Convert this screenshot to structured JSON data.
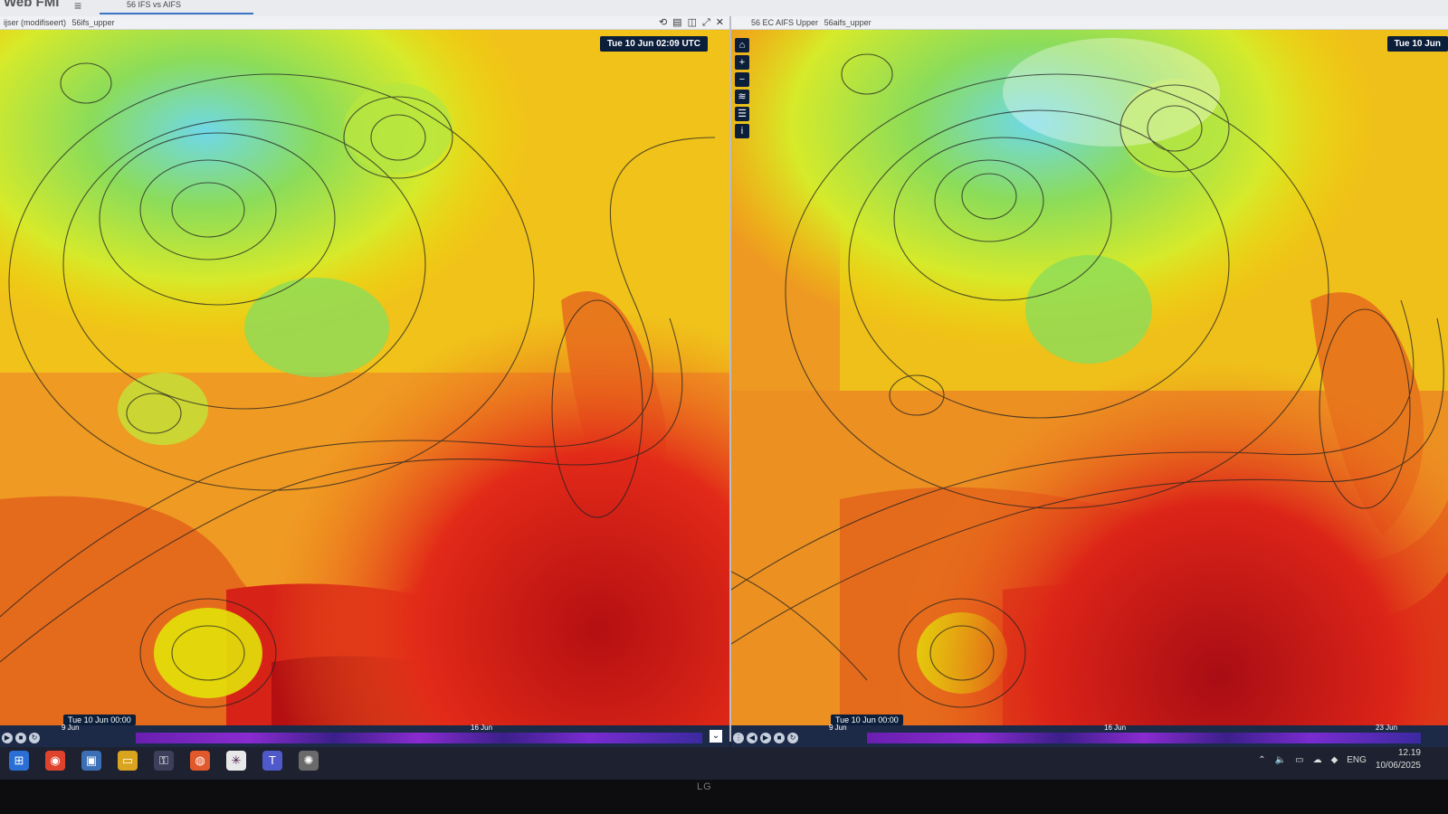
{
  "app": {
    "title": "Web FMI",
    "tab_label": "56 IFS vs AIFS"
  },
  "left_pane": {
    "title": "ijser (modifiseert)",
    "subtitle": "56ifs_upper",
    "time_badge": "Tue 10 Jun 02:09 UTC",
    "timeline_date": "Tue 10 Jun 00:00",
    "timeline_ticks": [
      "9 Jun",
      "16 Jun"
    ]
  },
  "right_pane": {
    "title": "56 EC AIFS Upper",
    "subtitle": "56aifs_upper",
    "time_badge": "Tue 10 Jun",
    "timeline_date": "Tue 10 Jun 00:00",
    "timeline_ticks": [
      "9 Jun",
      "16 Jun",
      "23 Jun"
    ]
  },
  "taskbar": {
    "language": "ENG",
    "time": "12.19",
    "date": "10/06/2025",
    "icons": [
      "windows-icon",
      "chrome-icon",
      "remote-desktop-icon",
      "file-explorer-icon",
      "vpn-icon",
      "firefox-icon",
      "slack-icon",
      "teams-icon",
      "misc-app-icon"
    ]
  },
  "monitor": {
    "brand": "LG"
  },
  "colors": {
    "heat_red": "#d01818",
    "warm_orange": "#ee7a1c",
    "yellow": "#f2e000",
    "green": "#8bdc5a",
    "cool_cyan": "#6fd8e8",
    "nav": "#0b1e3a"
  }
}
